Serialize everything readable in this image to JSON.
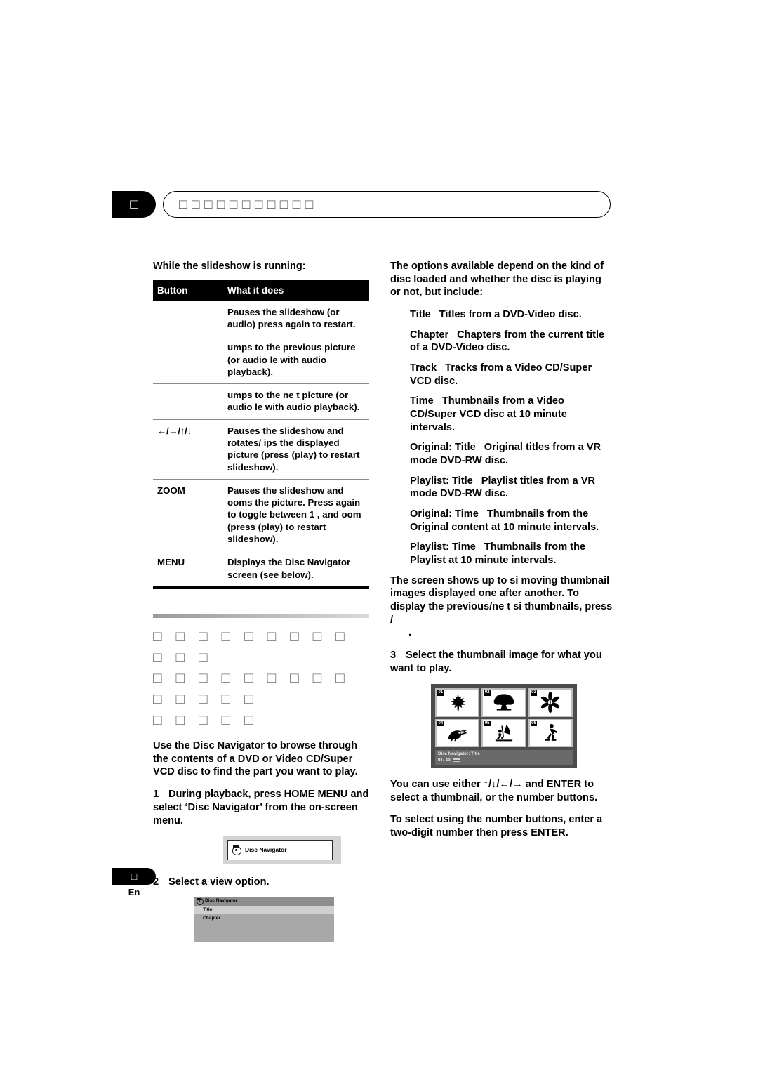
{
  "header": {
    "tab_glyph": "□",
    "title_glyphs": "□□□□□□□□□□□"
  },
  "left": {
    "subheading": "While the slideshow is running:",
    "table": {
      "columns": [
        "Button",
        "What it does"
      ],
      "rows": [
        {
          "button": "",
          "does": "Pauses the slideshow (or audio) press again to restart."
        },
        {
          "button": "",
          "does": " umps to the previous picture (or audio  le with audio playback)."
        },
        {
          "button": "",
          "does": " umps to the ne t picture (or audio  le with audio playback)."
        },
        {
          "button": "←/→/↑/↓",
          "does": "Pauses the slideshow and rotates/ ips the displayed picture (press  (play) to restart slideshow)."
        },
        {
          "button": "ZOOM",
          "does": "Pauses the slideshow and  ooms the picture. Press again to toggle between 1 ,  and  oom (press  (play) to restart slideshow)."
        },
        {
          "button": "MENU",
          "does": "Displays the Disc Navigator screen (see below)."
        }
      ]
    },
    "section_heading_lines": [
      "□ □ □ □ □ □ □ □ □ □ □ □",
      "□ □ □ □ □ □ □ □ □ □ □ □ □ □",
      "□ □ □ □ □"
    ],
    "intro_paragraph": "Use the Disc Navigator to browse through the contents of a DVD or Video CD/Super VCD disc to find the part you want to play.",
    "step1_num": "1",
    "step1_text": "During playback, press HOME MENU and select ‘Disc Navigator’ from the on-screen menu.",
    "disc_navigator_button_label": "Disc Navigator",
    "step2_num": "2",
    "step2_text": "Select a view option.",
    "disc_navigator_menu": {
      "title": "Disc Navigator",
      "items": [
        {
          "label": "Title",
          "selected": true
        },
        {
          "label": "Chapter",
          "selected": false
        }
      ]
    }
  },
  "right": {
    "intro_paragraph": "The options available depend on the kind of disc loaded and whether the disc is playing or not, but include:",
    "options": [
      {
        "term": "Title",
        "desc": "Titles from a DVD-Video disc."
      },
      {
        "term": "Chapter",
        "desc": "Chapters from the current title of a DVD-Video disc."
      },
      {
        "term": "Track",
        "desc": "Tracks from a Video CD/Super VCD disc."
      },
      {
        "term": "Time",
        "desc": "Thumbnails from a Video CD/Super VCD disc at 10 minute intervals."
      },
      {
        "term": "Original: Title",
        "desc": "Original titles from a VR mode DVD-RW disc."
      },
      {
        "term": "Playlist: Title",
        "desc": "Playlist titles from a VR mode DVD-RW disc."
      },
      {
        "term": "Original: Time",
        "desc": "Thumbnails from the Original content at 10 minute intervals."
      },
      {
        "term": "Playlist: Time",
        "desc": "Thumbnails from the Playlist at 10 minute intervals."
      }
    ],
    "screen_paragraph": "The screen shows up to si  moving thumbnail images displayed one after another. To display the previous/ne t si  thumbnails, press      /",
    "screen_paragraph_tail": ".",
    "step3_num": "3",
    "step3_text": "Select the thumbnail image for what you want to play.",
    "thumbnail_screen": {
      "thumbs": [
        {
          "num": "01",
          "icon": "maple-leaf-icon"
        },
        {
          "num": "02",
          "icon": "tree-icon"
        },
        {
          "num": "03",
          "icon": "flower-icon"
        },
        {
          "num": "04",
          "icon": "toucan-icon"
        },
        {
          "num": "05",
          "icon": "windsurfer-icon"
        },
        {
          "num": "06",
          "icon": "skater-icon"
        }
      ],
      "status_title": "Disc Navigator: Title",
      "status_range": "01- 49:"
    },
    "after_paragraph_1": "You can use either ↑/↓/←/→ and ENTER to select a thumbnail, or the number buttons.",
    "after_paragraph_2": "To select using the number buttons, enter a two-digit number then press ENTER."
  },
  "footer": {
    "page_glyph": "□",
    "language": "En"
  }
}
